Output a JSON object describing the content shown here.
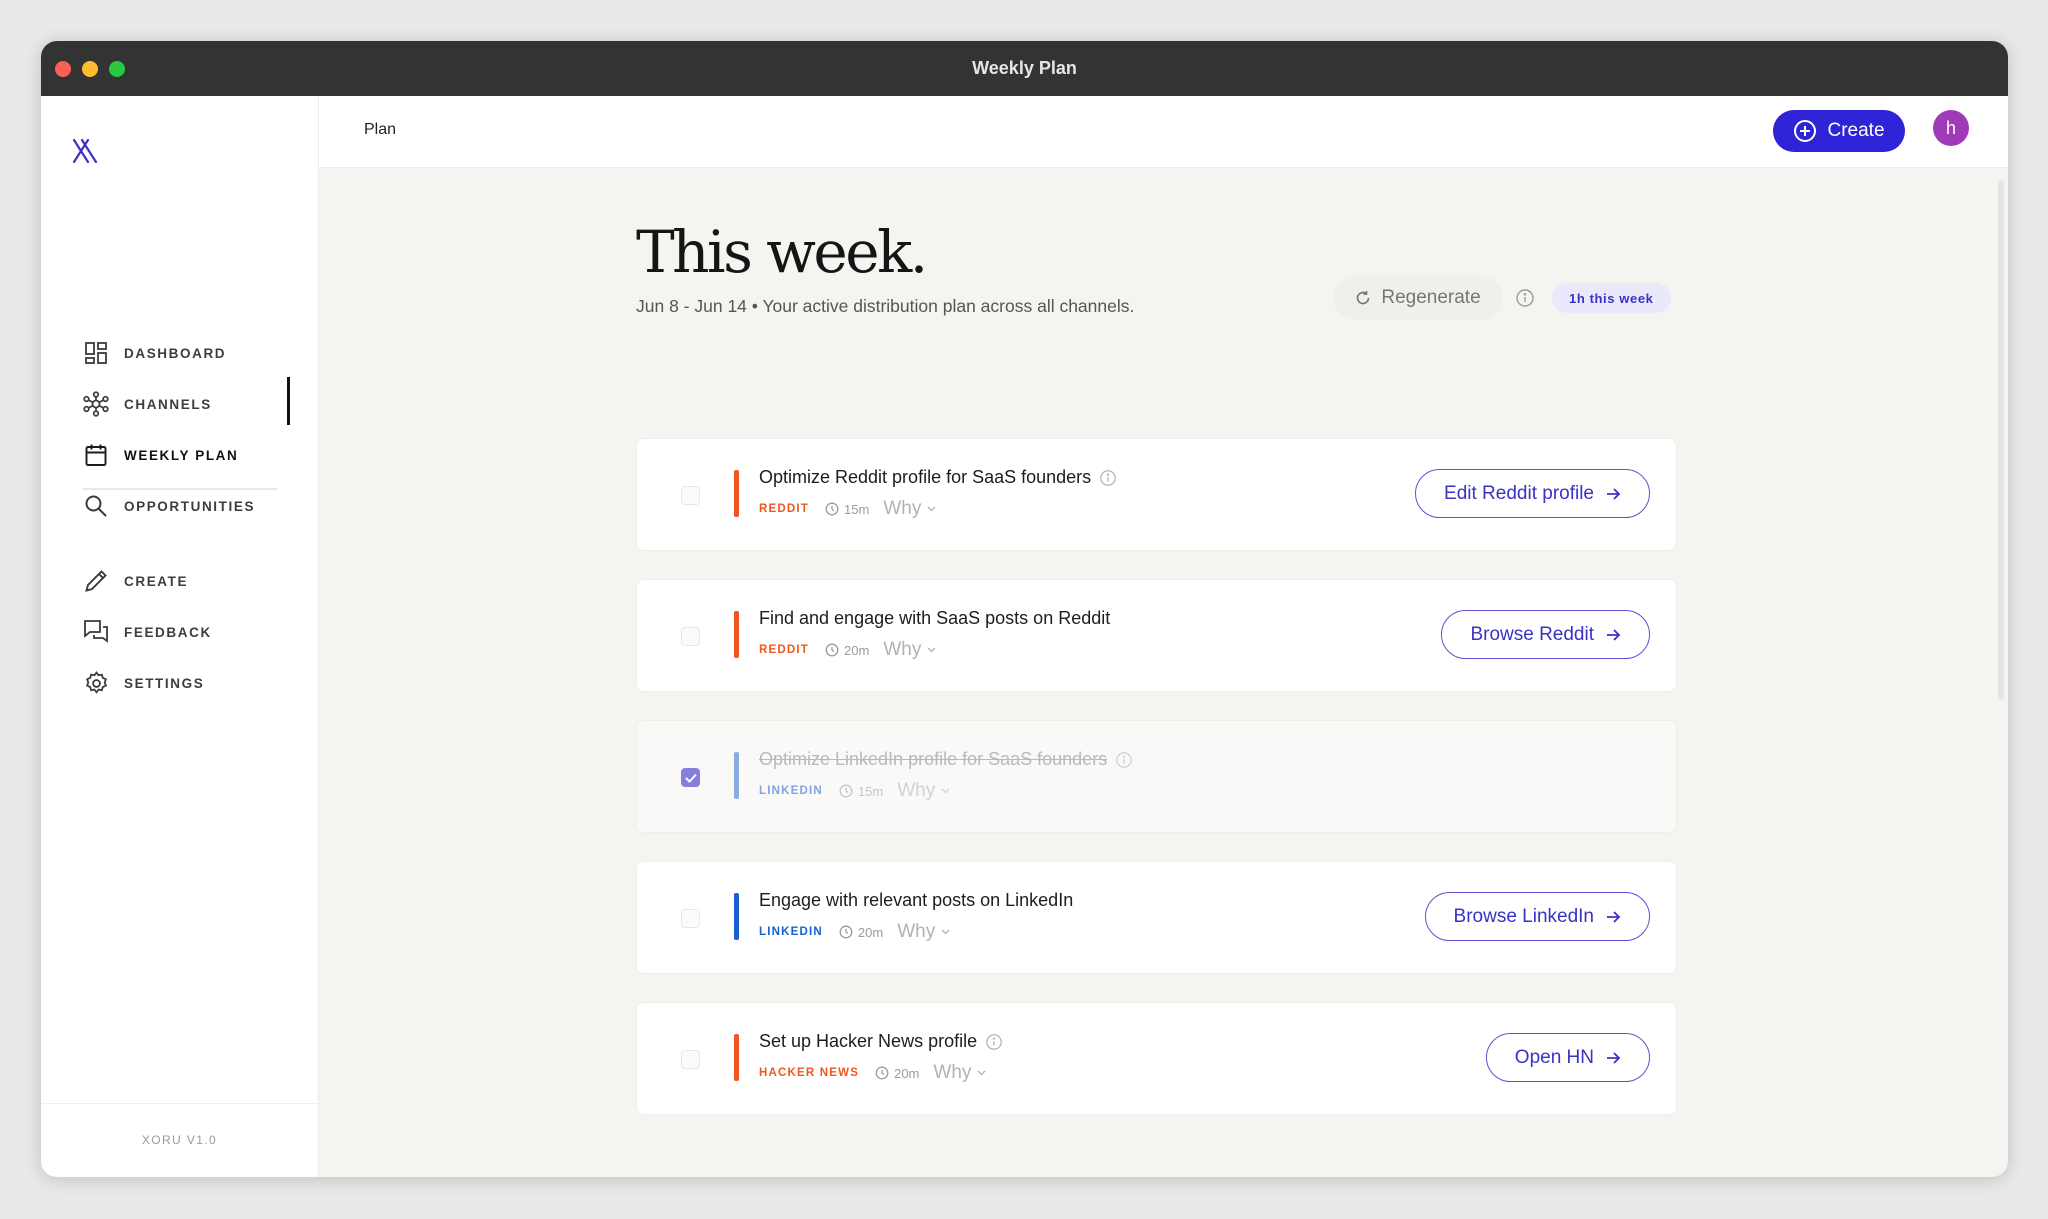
{
  "window": {
    "title": "Weekly Plan"
  },
  "sidebar": {
    "items": [
      {
        "label": "DASHBOARD",
        "icon": "dashboard-grid-icon"
      },
      {
        "label": "CHANNELS",
        "icon": "channels-network-icon"
      },
      {
        "label": "WEEKLY PLAN",
        "icon": "calendar-icon",
        "active": true
      },
      {
        "label": "OPPORTUNITIES",
        "icon": "search-icon"
      },
      {
        "label": "CREATE",
        "icon": "pencil-icon"
      },
      {
        "label": "FEEDBACK",
        "icon": "chat-bubbles-icon"
      },
      {
        "label": "SETTINGS",
        "icon": "gear-icon"
      }
    ],
    "version": "XORU V1.0"
  },
  "topbar": {
    "breadcrumb": "Plan",
    "create_label": "Create",
    "avatar_initial": "h"
  },
  "main": {
    "title": "This week.",
    "subtitle": "Jun 8 - Jun 14 • Your active distribution plan across all channels.",
    "regenerate_label": "Regenerate",
    "time_badge": "1h this week"
  },
  "colors": {
    "reddit": "#f0561d",
    "linkedin": "#1a5fd0",
    "hacker_news": "#f0561d",
    "accent": "#2e23d6"
  },
  "tasks": [
    {
      "title": "Optimize Reddit profile for SaaS founders",
      "channel": "REDDIT",
      "duration": "15m",
      "why": "Why",
      "action": "Edit Reddit profile",
      "done": false,
      "info": true
    },
    {
      "title": "Find and engage with SaaS posts on Reddit",
      "channel": "REDDIT",
      "duration": "20m",
      "why": "Why",
      "action": "Browse Reddit",
      "done": false,
      "info": false
    },
    {
      "title": "Optimize LinkedIn profile for SaaS founders",
      "channel": "LINKEDIN",
      "duration": "15m",
      "why": "Why",
      "action": "",
      "done": true,
      "info": true
    },
    {
      "title": "Engage with relevant posts on LinkedIn",
      "channel": "LINKEDIN",
      "duration": "20m",
      "why": "Why",
      "action": "Browse LinkedIn",
      "done": false,
      "info": false
    },
    {
      "title": "Set up Hacker News profile",
      "channel": "HACKER NEWS",
      "duration": "20m",
      "why": "Why",
      "action": "Open HN",
      "done": false,
      "info": true
    }
  ]
}
